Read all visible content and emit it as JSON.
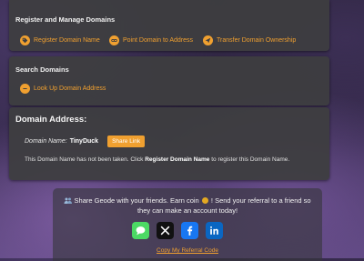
{
  "register": {
    "title": "Register and Manage Domains",
    "actions": [
      {
        "label": "Register Domain Name",
        "icon": "tag-icon"
      },
      {
        "label": "Point Domain to Address",
        "icon": "link-icon"
      },
      {
        "label": "Transfer Domain Ownership",
        "icon": "send-icon"
      }
    ]
  },
  "search": {
    "title": "Search Domains",
    "actions": [
      {
        "label": "Look Up Domain Address",
        "icon": "minus-circle-icon"
      }
    ]
  },
  "domain": {
    "heading": "Domain Address:",
    "name_label": "Domain Name:",
    "name_value": "TinyDuck",
    "share_button": "Share Link",
    "message_prefix": "This Domain Name has not been taken. Click ",
    "message_bold": "Register Domain Name",
    "message_suffix": " to register this Domain Name."
  },
  "referral": {
    "text_line1": "Share Geode with your friends. Earn coin",
    "text_line1_end": "! Send your referral to a friend so",
    "text_line2": "they can make an account today!",
    "copy_link": "Copy My Referral Code",
    "share_targets": [
      "messages-icon",
      "x-icon",
      "facebook-icon",
      "linkedin-icon"
    ]
  },
  "colors": {
    "accent": "#f0a030",
    "panel": "#3e3e40"
  }
}
